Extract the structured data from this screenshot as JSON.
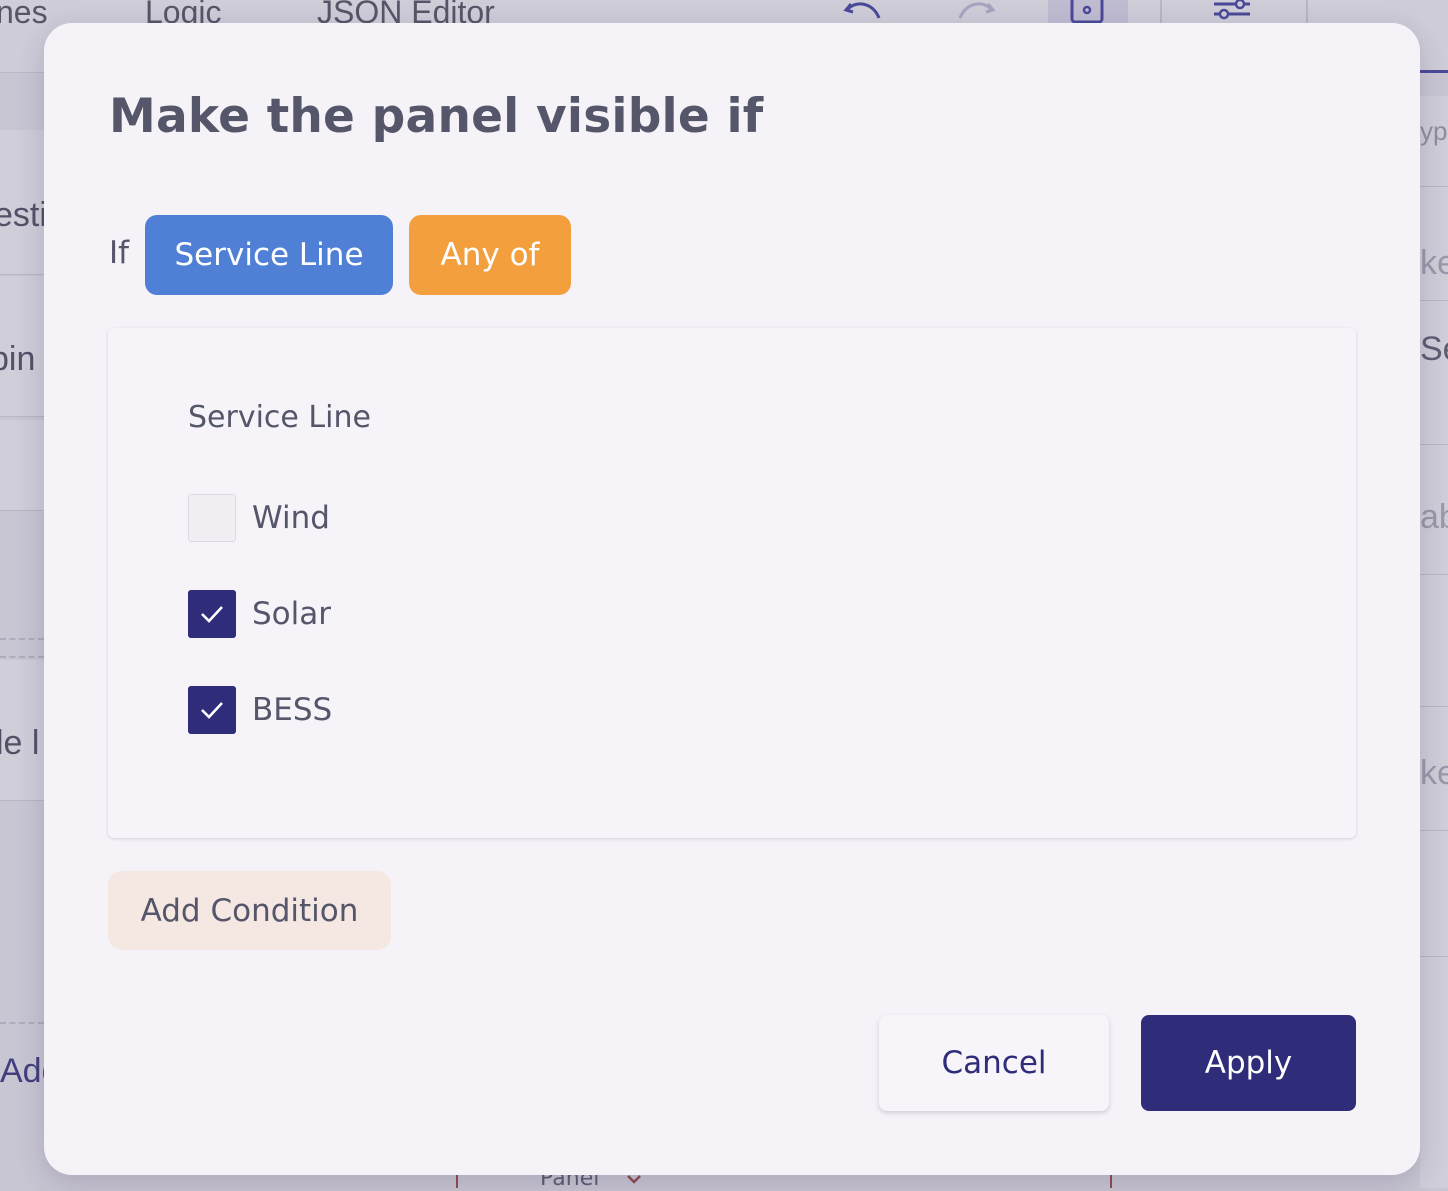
{
  "background": {
    "tabs": [
      "nes",
      "Logic",
      "JSON Editor"
    ],
    "left_fragments": [
      "esti",
      "pin",
      "le l",
      "Add"
    ],
    "right_fragments": [
      "ype",
      "ke",
      "Se",
      "ab",
      "ke"
    ],
    "bottom_label": "Panel"
  },
  "dialog": {
    "title": "Make the panel visible if",
    "if_label": "If",
    "question_chip": "Service Line",
    "operator_chip": "Any of",
    "question": {
      "title": "Service Line",
      "options": [
        {
          "label": "Wind",
          "checked": false
        },
        {
          "label": "Solar",
          "checked": true
        },
        {
          "label": "BESS",
          "checked": true
        }
      ]
    },
    "add_condition_label": "Add Condition",
    "cancel_label": "Cancel",
    "apply_label": "Apply"
  },
  "colors": {
    "question_chip": "#5080d6",
    "operator_chip": "#f39f3e",
    "primary": "#2f2c79",
    "add_condition_bg": "#f5e8e3"
  },
  "icons": [
    "undo-icon",
    "redo-icon",
    "designer-icon",
    "settings-sliders-icon",
    "check-icon",
    "chevron-down-icon"
  ]
}
